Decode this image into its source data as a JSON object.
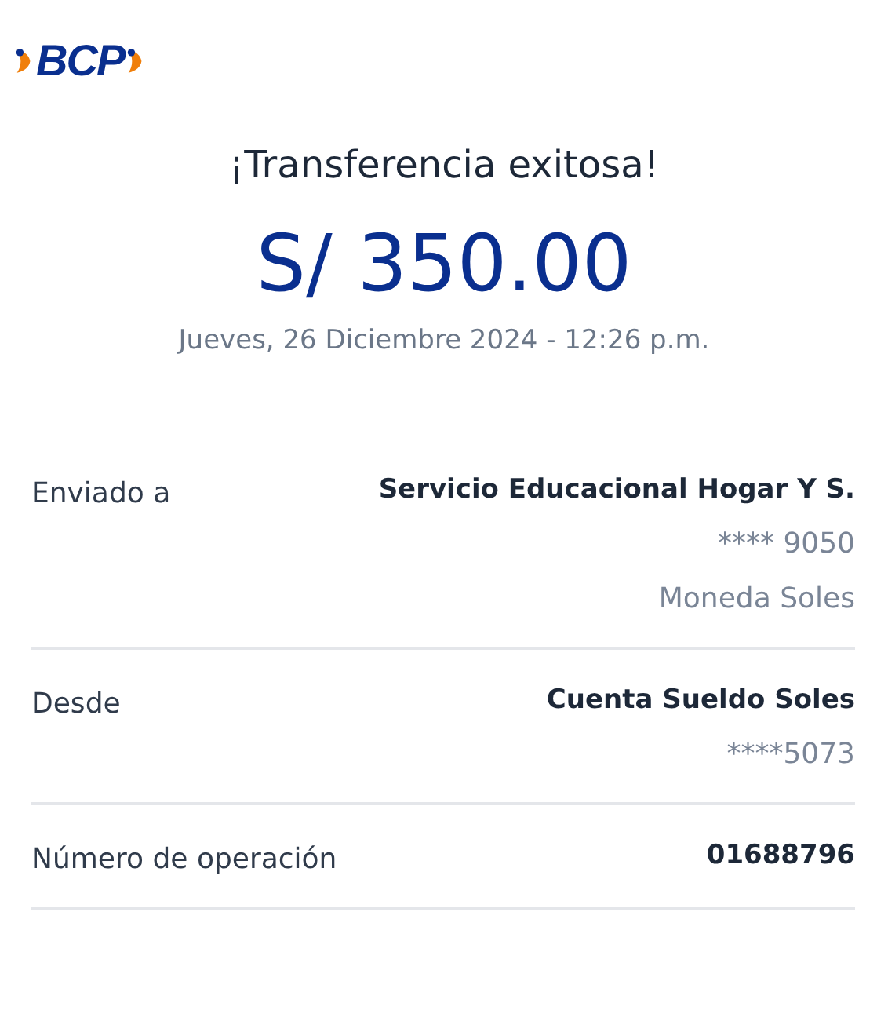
{
  "logo": {
    "text": "BCP"
  },
  "title": "¡Transferencia exitosa!",
  "amount": "S/ 350.00",
  "datetime": "Jueves, 26 Diciembre 2024 - 12:26 p.m.",
  "details": [
    {
      "label": "Enviado a",
      "values": [
        "Servicio Educacional Hogar Y S.",
        "**** 9050",
        "Moneda Soles"
      ]
    },
    {
      "label": "Desde",
      "values": [
        "Cuenta Sueldo Soles",
        "****5073"
      ]
    },
    {
      "label": "Número de operación",
      "values": [
        "01688796"
      ]
    }
  ]
}
